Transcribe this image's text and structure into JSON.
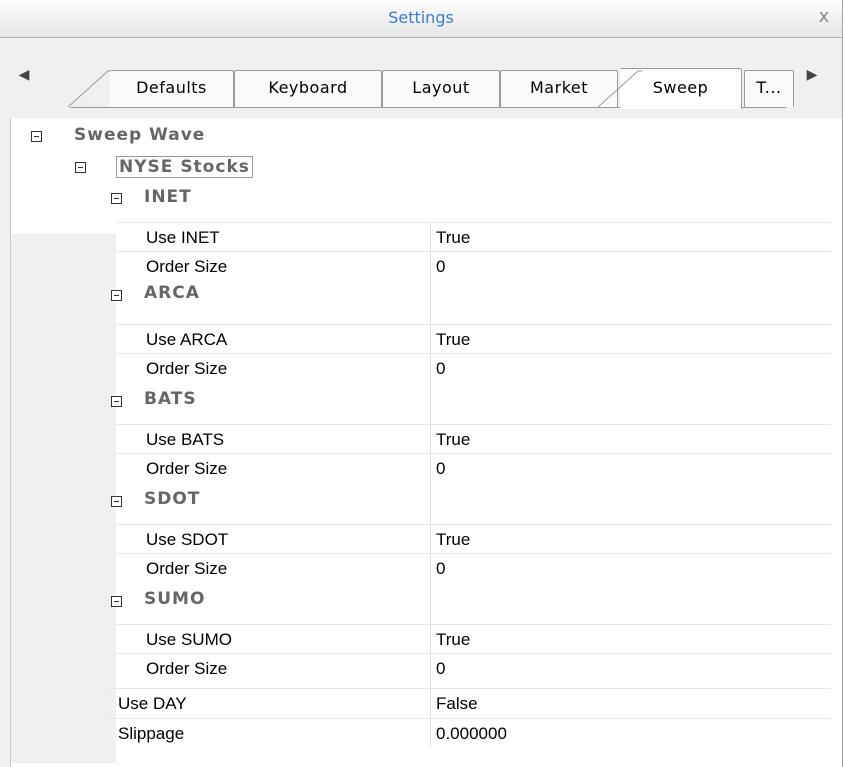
{
  "window": {
    "title": "Settings",
    "close_glyph": "x"
  },
  "tabs": [
    {
      "label": "Defaults",
      "active": false
    },
    {
      "label": "Keyboard",
      "active": false
    },
    {
      "label": "Layout",
      "active": false
    },
    {
      "label": "Market",
      "active": false
    },
    {
      "label": "Sweep",
      "active": true
    },
    {
      "label": "T...",
      "active": false
    }
  ],
  "tree": {
    "root": {
      "label": "Sweep Wave",
      "expanded": true
    },
    "group": {
      "label": "NYSE Stocks",
      "expanded": true
    },
    "venues": [
      {
        "label": "INET",
        "use_label": "Use INET",
        "use_value": "True",
        "size_label": "Order Size",
        "size_value": "0"
      },
      {
        "label": "ARCA",
        "use_label": "Use ARCA",
        "use_value": "True",
        "size_label": "Order Size",
        "size_value": "0"
      },
      {
        "label": "BATS",
        "use_label": "Use BATS",
        "use_value": "True",
        "size_label": "Order Size",
        "size_value": "0"
      },
      {
        "label": "SDOT",
        "use_label": "Use SDOT",
        "use_value": "True",
        "size_label": "Order Size",
        "size_value": "0"
      },
      {
        "label": "SUMO",
        "use_label": "Use SUMO",
        "use_value": "True",
        "size_label": "Order Size",
        "size_value": "0"
      }
    ],
    "use_day": {
      "label": "Use DAY",
      "value": "False"
    },
    "slippage": {
      "label": "Slippage",
      "value": "0.000000"
    }
  },
  "colors": {
    "title_text": "#3a7bd5",
    "category_text": "#666666"
  },
  "icons": {
    "collapse": "minus-box-icon",
    "scroll_left": "triangle-left-icon",
    "scroll_right": "triangle-right-icon",
    "close": "close-icon"
  }
}
